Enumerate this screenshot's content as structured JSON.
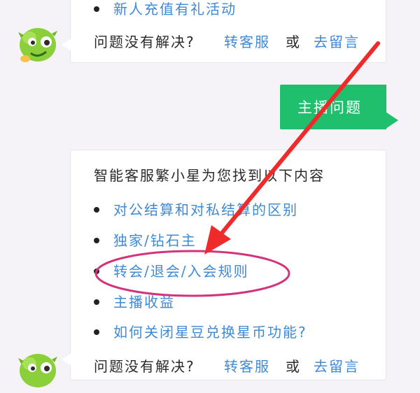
{
  "chat": {
    "top_message": {
      "partial_link": "新人充值有礼活动",
      "footer_prefix": "问题没有解决?",
      "transfer_link": "转客服",
      "or_text": "或",
      "leave_message_link": "去留言"
    },
    "user_message": {
      "text": "主播问题"
    },
    "bot_message": {
      "intro": "智能客服繁小星为您找到以下内容",
      "items": [
        {
          "label": "对公结算和对私结算的区别"
        },
        {
          "label": "独家/钻石主"
        },
        {
          "label": "转会/退会/入会规则"
        },
        {
          "label": "主播收益"
        },
        {
          "label": "如何关闭星豆兑换星币功能?"
        }
      ],
      "footer_prefix": "问题没有解决?",
      "transfer_link": "转客服",
      "or_text": "或",
      "leave_message_link": "去留言"
    }
  },
  "colors": {
    "link": "#3e8ad6",
    "user_bubble": "#1fbf6e",
    "annotation_red": "#ee2a2a",
    "highlight_ellipse": "#d3337a"
  }
}
